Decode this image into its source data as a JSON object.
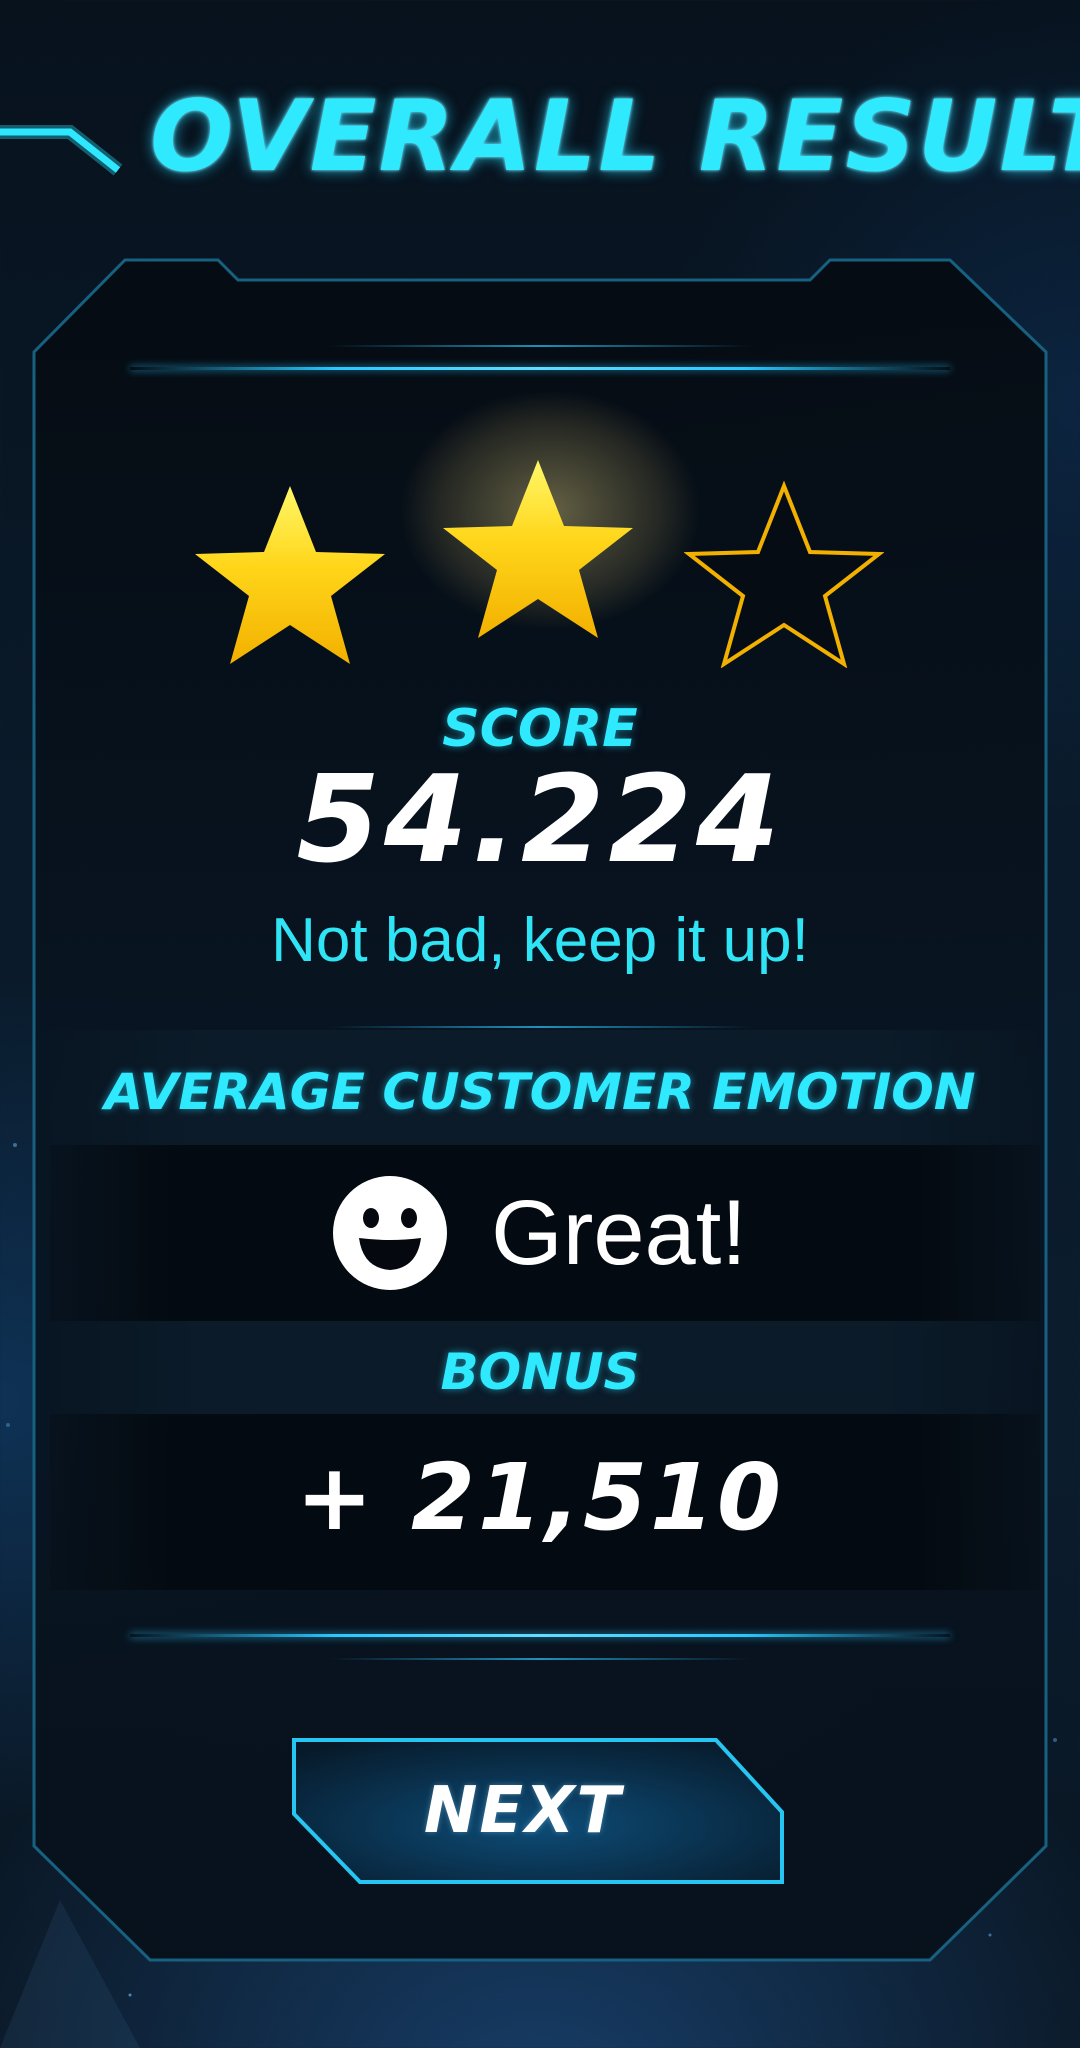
{
  "header": {
    "title": "OVERALL RESULT"
  },
  "result": {
    "stars_earned": 2,
    "stars_total": 3,
    "score_label": "SCORE",
    "score_value": "54.224",
    "message": "Not bad, keep it up!"
  },
  "emotion": {
    "label": "AVERAGE CUSTOMER EMOTION",
    "icon": "smiley-face-icon",
    "value": "Great!"
  },
  "bonus": {
    "label": "BONUS",
    "value": "+ 21,510"
  },
  "next_button": {
    "label": "NEXT"
  },
  "colors": {
    "accent_cyan": "#2fe9ff",
    "star_gold": "#f6c21a",
    "panel_border": "#1a6e8f",
    "button_border": "#27c6f2"
  }
}
